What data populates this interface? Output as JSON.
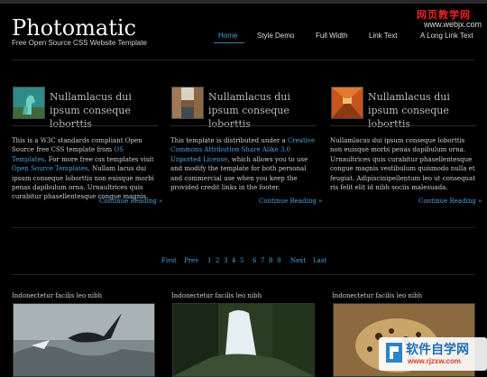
{
  "site": {
    "title": "Photomatic",
    "tagline": "Free Open Source CSS Website Template"
  },
  "nav": {
    "items": [
      {
        "label": "Home"
      },
      {
        "label": "Style Demo"
      },
      {
        "label": "Full Width"
      },
      {
        "label": "Link Text"
      },
      {
        "label": "A Long Link Text"
      }
    ]
  },
  "watermark_top": {
    "line1": "网页教学网",
    "line2": "www.webjx.com"
  },
  "posts": [
    {
      "heading": "Nullamlacus dui ipsum conseque loborttis",
      "continue": "Continue Reading »",
      "b0": "This is a W3C standards compliant Open Source free CSS template from ",
      "b0_link": "OS Templates",
      "b1": ". For more free css templates visit ",
      "b1_link": "Open Source Templates",
      "b2": ". Nullam lacus dui ipsum conseque loborttis non euisque morbi penas dapibulum orna. Urnaultrices quis curabitur phasellentesque congue magnis."
    },
    {
      "heading": "Nullamlacus dui ipsum conseque loborttis",
      "continue": "Continue Reading »",
      "b0": "This template is distributed under a ",
      "b0_link": "Creative Commons Attribution-Share Alike 3.0 Unported License",
      "b1": ", which allows you to use and modify the template for both personal and commercial use when you keep the provided credit links in the footer."
    },
    {
      "heading": "Nullamlacus dui ipsum conseque loborttis",
      "continue": "Continue Reading »",
      "b0": "Nullamlacus dui ipsum conseque loborttis non euisque morbi penas dapibulum orna. Urnaultrices quis curabitur phasellentesque congue magnis vestibulum quismodo nulla et feugiat. Adipiscinipellentum leo ut consequat ris felit elit id nibh sociis malesuada."
    }
  ],
  "pagination": {
    "first": "First",
    "prev": "Prev",
    "pages": [
      "1",
      "2",
      "3",
      "4",
      "5",
      "6",
      "7",
      "8",
      "9"
    ],
    "next": "Next",
    "last": "Last"
  },
  "gallery": [
    {
      "caption": "Indonectetur facilis leo nibh"
    },
    {
      "caption": "Indonectetur facilis leo nibh"
    },
    {
      "caption": "Indonectetur facilis leo nibh"
    }
  ],
  "watermark_bottom": {
    "brand": "软件自学网",
    "url": "www.rjzxw.com"
  }
}
